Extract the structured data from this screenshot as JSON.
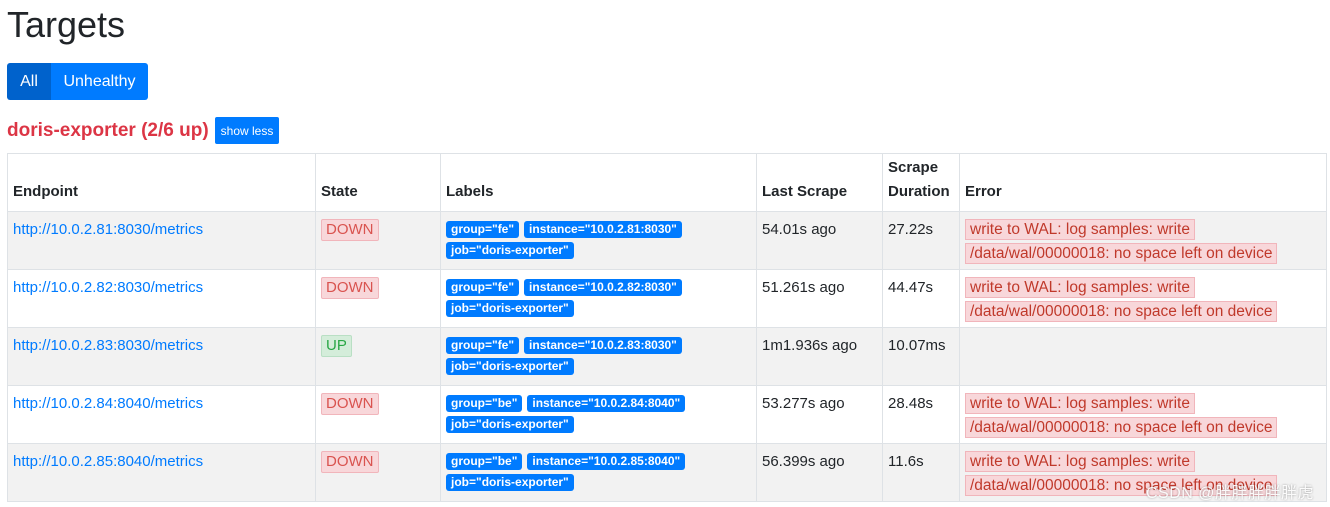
{
  "header": {
    "title": "Targets"
  },
  "filters": {
    "all_label": "All",
    "unhealthy_label": "Unhealthy"
  },
  "job": {
    "title": "doris-exporter (2/6 up)",
    "toggle_label": "show less"
  },
  "table": {
    "columns": {
      "endpoint": "Endpoint",
      "state": "State",
      "labels": "Labels",
      "last_scrape": "Last Scrape",
      "scrape_duration_line1": "Scrape",
      "scrape_duration_line2": "Duration",
      "error": "Error"
    },
    "rows": [
      {
        "endpoint": "http://10.0.2.81:8030/metrics",
        "state": "DOWN",
        "labels": [
          "group=\"fe\"",
          "instance=\"10.0.2.81:8030\"",
          "job=\"doris-exporter\""
        ],
        "last_scrape": "54.01s ago",
        "duration": "27.22s",
        "error": "write to WAL: log samples: write /data/wal/00000018: no space left on device"
      },
      {
        "endpoint": "http://10.0.2.82:8030/metrics",
        "state": "DOWN",
        "labels": [
          "group=\"fe\"",
          "instance=\"10.0.2.82:8030\"",
          "job=\"doris-exporter\""
        ],
        "last_scrape": "51.261s ago",
        "duration": "44.47s",
        "error": "write to WAL: log samples: write /data/wal/00000018: no space left on device"
      },
      {
        "endpoint": "http://10.0.2.83:8030/metrics",
        "state": "UP",
        "labels": [
          "group=\"fe\"",
          "instance=\"10.0.2.83:8030\"",
          "job=\"doris-exporter\""
        ],
        "last_scrape": "1m1.936s ago",
        "duration": "10.07ms",
        "error": ""
      },
      {
        "endpoint": "http://10.0.2.84:8040/metrics",
        "state": "DOWN",
        "labels": [
          "group=\"be\"",
          "instance=\"10.0.2.84:8040\"",
          "job=\"doris-exporter\""
        ],
        "last_scrape": "53.277s ago",
        "duration": "28.48s",
        "error": "write to WAL: log samples: write /data/wal/00000018: no space left on device"
      },
      {
        "endpoint": "http://10.0.2.85:8040/metrics",
        "state": "DOWN",
        "labels": [
          "group=\"be\"",
          "instance=\"10.0.2.85:8040\"",
          "job=\"doris-exporter\""
        ],
        "last_scrape": "56.399s ago",
        "duration": "11.6s",
        "error": "write to WAL: log samples: write /data/wal/00000018: no space left on device"
      }
    ]
  },
  "watermark": "CSDN @胖胖胖胖胖虎",
  "colors": {
    "accent": "#007bff",
    "accent_active": "#0062cc",
    "danger": "#dc3545",
    "down_bg": "#f8d7da",
    "up_bg": "#d4edda"
  }
}
